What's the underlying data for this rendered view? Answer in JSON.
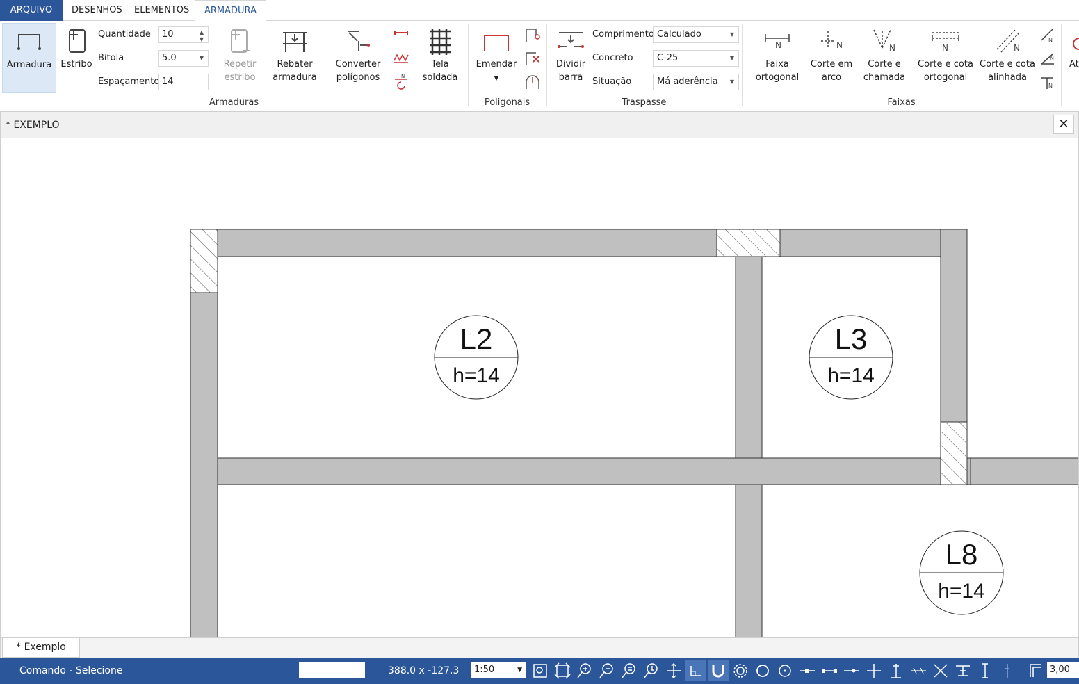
{
  "menu": {
    "tabs": [
      "ARQUIVO",
      "DESENHOS",
      "ELEMENTOS",
      "ARMADURA"
    ]
  },
  "ribbon": {
    "armadura": "Armadura",
    "estribo": "Estribo",
    "quantidade_label": "Quantidade",
    "quantidade_value": "10",
    "bitola_label": "Bitola",
    "bitola_value": "5.0",
    "espacamento_label": "Espaçamento",
    "espacamento_value": "14",
    "repetir_1": "Repetir",
    "repetir_2": "estribo",
    "rebater_1": "Rebater",
    "rebater_2": "armadura",
    "converter_1": "Converter",
    "converter_2": "polígonos",
    "tela_1": "Tela",
    "tela_2": "soldada",
    "grp_armaduras": "Armaduras",
    "emendar": "Emendar",
    "grp_poligonais": "Poligonais",
    "dividir_1": "Dividir",
    "dividir_2": "barra",
    "comprimento_label": "Comprimento",
    "comprimento_value": "Calculado",
    "concreto_label": "Concreto",
    "concreto_value": "C-25",
    "situacao_label": "Situação",
    "situacao_value": "Má aderência",
    "grp_traspasse": "Traspasse",
    "faixa_1": "Faixa",
    "faixa_2": "ortogonal",
    "corte_arco_1": "Corte em",
    "corte_arco_2": "arco",
    "corte_chamada_1": "Corte e",
    "corte_chamada_2": "chamada",
    "corte_ortogonal_1": "Corte e cota",
    "corte_ortogonal_2": "ortogonal",
    "corte_alinhada_1": "Corte e cota",
    "corte_alinhada_2": "alinhada",
    "grp_faixas": "Faixas",
    "at": "At"
  },
  "document": {
    "title": "* EXEMPLO",
    "sheet_tab": "* Exemplo",
    "slabs": [
      {
        "name": "L2",
        "h": "h=14"
      },
      {
        "name": "L3",
        "h": "h=14"
      },
      {
        "name": "L8",
        "h": "h=14"
      }
    ]
  },
  "status": {
    "command": "Comando - Selecione",
    "coords": "388.0 x -127.3",
    "scale": "1:50",
    "value": "3,00"
  }
}
